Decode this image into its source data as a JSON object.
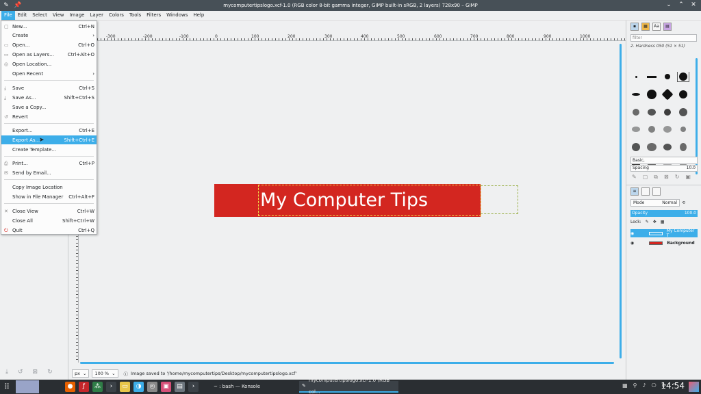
{
  "window": {
    "title": "mycomputertipslogo.xcf-1.0 (RGB color 8-bit gamma integer, GIMP built-in sRGB, 2 layers) 728x90 – GIMP"
  },
  "menubar": [
    "File",
    "Edit",
    "Select",
    "View",
    "Image",
    "Layer",
    "Colors",
    "Tools",
    "Filters",
    "Windows",
    "Help"
  ],
  "file_menu": {
    "new": {
      "label": "New...",
      "accel": "Ctrl+N"
    },
    "create": {
      "label": "Create",
      "accel": "›"
    },
    "open": {
      "label": "Open...",
      "accel": "Ctrl+O"
    },
    "open_layers": {
      "label": "Open as Layers...",
      "accel": "Ctrl+Alt+O"
    },
    "open_location": {
      "label": "Open Location...",
      "accel": ""
    },
    "open_recent": {
      "label": "Open Recent",
      "accel": "›"
    },
    "save": {
      "label": "Save",
      "accel": "Ctrl+S"
    },
    "save_as": {
      "label": "Save As...",
      "accel": "Shift+Ctrl+S"
    },
    "save_copy": {
      "label": "Save a Copy...",
      "accel": ""
    },
    "revert": {
      "label": "Revert",
      "accel": ""
    },
    "export": {
      "label": "Export...",
      "accel": "Ctrl+E"
    },
    "export_as": {
      "label": "Export As...",
      "accel": "Shift+Ctrl+E"
    },
    "create_template": {
      "label": "Create Template...",
      "accel": ""
    },
    "print": {
      "label": "Print...",
      "accel": "Ctrl+P"
    },
    "send_email": {
      "label": "Send by Email...",
      "accel": ""
    },
    "copy_location": {
      "label": "Copy Image Location",
      "accel": ""
    },
    "show_file_manager": {
      "label": "Show in File Manager",
      "accel": "Ctrl+Alt+F"
    },
    "close_view": {
      "label": "Close View",
      "accel": "Ctrl+W"
    },
    "close_all": {
      "label": "Close All",
      "accel": "Shift+Ctrl+W"
    },
    "quit": {
      "label": "Quit",
      "accel": "Ctrl+Q"
    }
  },
  "ruler": {
    "h_labels": [
      "-300",
      "-200",
      "-100",
      "0",
      "100",
      "200",
      "300",
      "400",
      "500",
      "600",
      "700",
      "800",
      "900",
      "1000"
    ]
  },
  "canvas": {
    "logo_text": "My Computer Tips",
    "logo_color": "#d32620"
  },
  "status": {
    "unit": "px",
    "zoom": "100 %",
    "message": "Image saved to '/home/mycomputertips/Desktop/mycomputertipslogo.xcf'"
  },
  "brushes": {
    "filter_placeholder": "filter",
    "current": "2. Hardness 050 (51 × 51)",
    "preset": "Basic,",
    "spacing_label": "Spacing",
    "spacing_value": "10.0"
  },
  "layers": {
    "mode_label": "Mode",
    "mode_value": "Normal",
    "opacity_label": "Opacity",
    "opacity_value": "100.0",
    "lock_label": "Lock:",
    "items": [
      {
        "name": "My Computer T",
        "selected": true
      },
      {
        "name": "Background",
        "selected": false
      }
    ]
  },
  "taskbar": {
    "tasks": [
      "~ : bash — Konsole",
      "mycomputertipslogo.xcf-1.0 (RGB col..."
    ],
    "clock": "14:54"
  },
  "colors": {
    "accent": "#3daee9",
    "titlebar": "#475057",
    "taskbar": "#2a2e32"
  }
}
